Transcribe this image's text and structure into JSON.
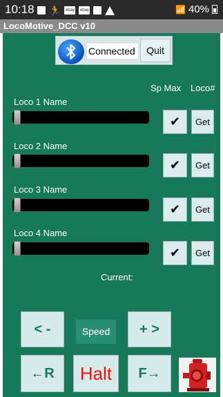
{
  "status_bar": {
    "time": "10:18",
    "signal_text": "40%"
  },
  "app": {
    "title": "LocoMotive_DCC v10"
  },
  "connection": {
    "status": "Connected",
    "quit_label": "Quit",
    "icon": "bluetooth-icon"
  },
  "headers": {
    "sp_max": "Sp Max",
    "loco_num": "Loco#"
  },
  "locos": [
    {
      "name": "Loco 1 Name",
      "speed": 0,
      "check": "✔",
      "get": "Get"
    },
    {
      "name": "Loco 2 Name",
      "speed": 0,
      "check": "✔",
      "get": "Get"
    },
    {
      "name": "Loco 3 Name",
      "speed": 0,
      "check": "✔",
      "get": "Get"
    },
    {
      "name": "Loco 4 Name",
      "speed": 0,
      "check": "✔",
      "get": "Get"
    }
  ],
  "current_label": "Current:",
  "controls": {
    "minus": "< -",
    "speed": "Speed",
    "plus": "+ >",
    "reverse": "←R",
    "halt": "Halt",
    "forward": "F→"
  },
  "colors": {
    "background": "#17785a",
    "accent": "#17785a",
    "halt": "#ee1111"
  }
}
